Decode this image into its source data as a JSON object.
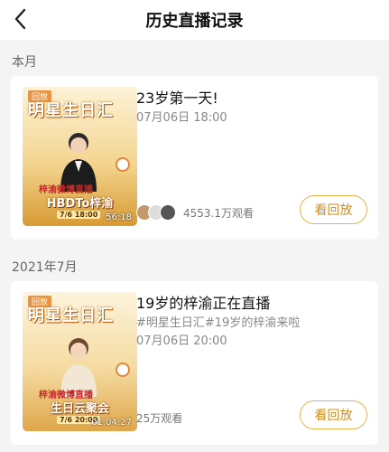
{
  "header": {
    "title": "历史直播记录"
  },
  "sections": [
    {
      "label": "本月",
      "record": {
        "title": "23岁第一天!",
        "time": "07月06日 18:00",
        "viewers": "4553.1万观看",
        "replay_label": "看回放",
        "thumbnail": {
          "tag": "回放",
          "brand": "明星生日汇",
          "line1": "梓渝微博直播",
          "line2": "HBDTo梓渝",
          "date": "7/6 18:00",
          "duration": "56:18"
        }
      }
    },
    {
      "label": "2021年7月",
      "record": {
        "title": "19岁的梓渝正在直播",
        "tags": "#明星生日汇#19岁的梓渝来啦",
        "time": "07月06日 20:00",
        "viewers": "25万观看",
        "replay_label": "看回放",
        "thumbnail": {
          "tag": "回放",
          "brand": "明星生日汇",
          "line1": "梓渝微博直播",
          "line2": "生日云聚会",
          "date": "7/6 20:00",
          "duration": "01:04:27"
        }
      }
    }
  ],
  "colors": {
    "accent": "#d28d17",
    "accent_border": "#e3b44e"
  }
}
